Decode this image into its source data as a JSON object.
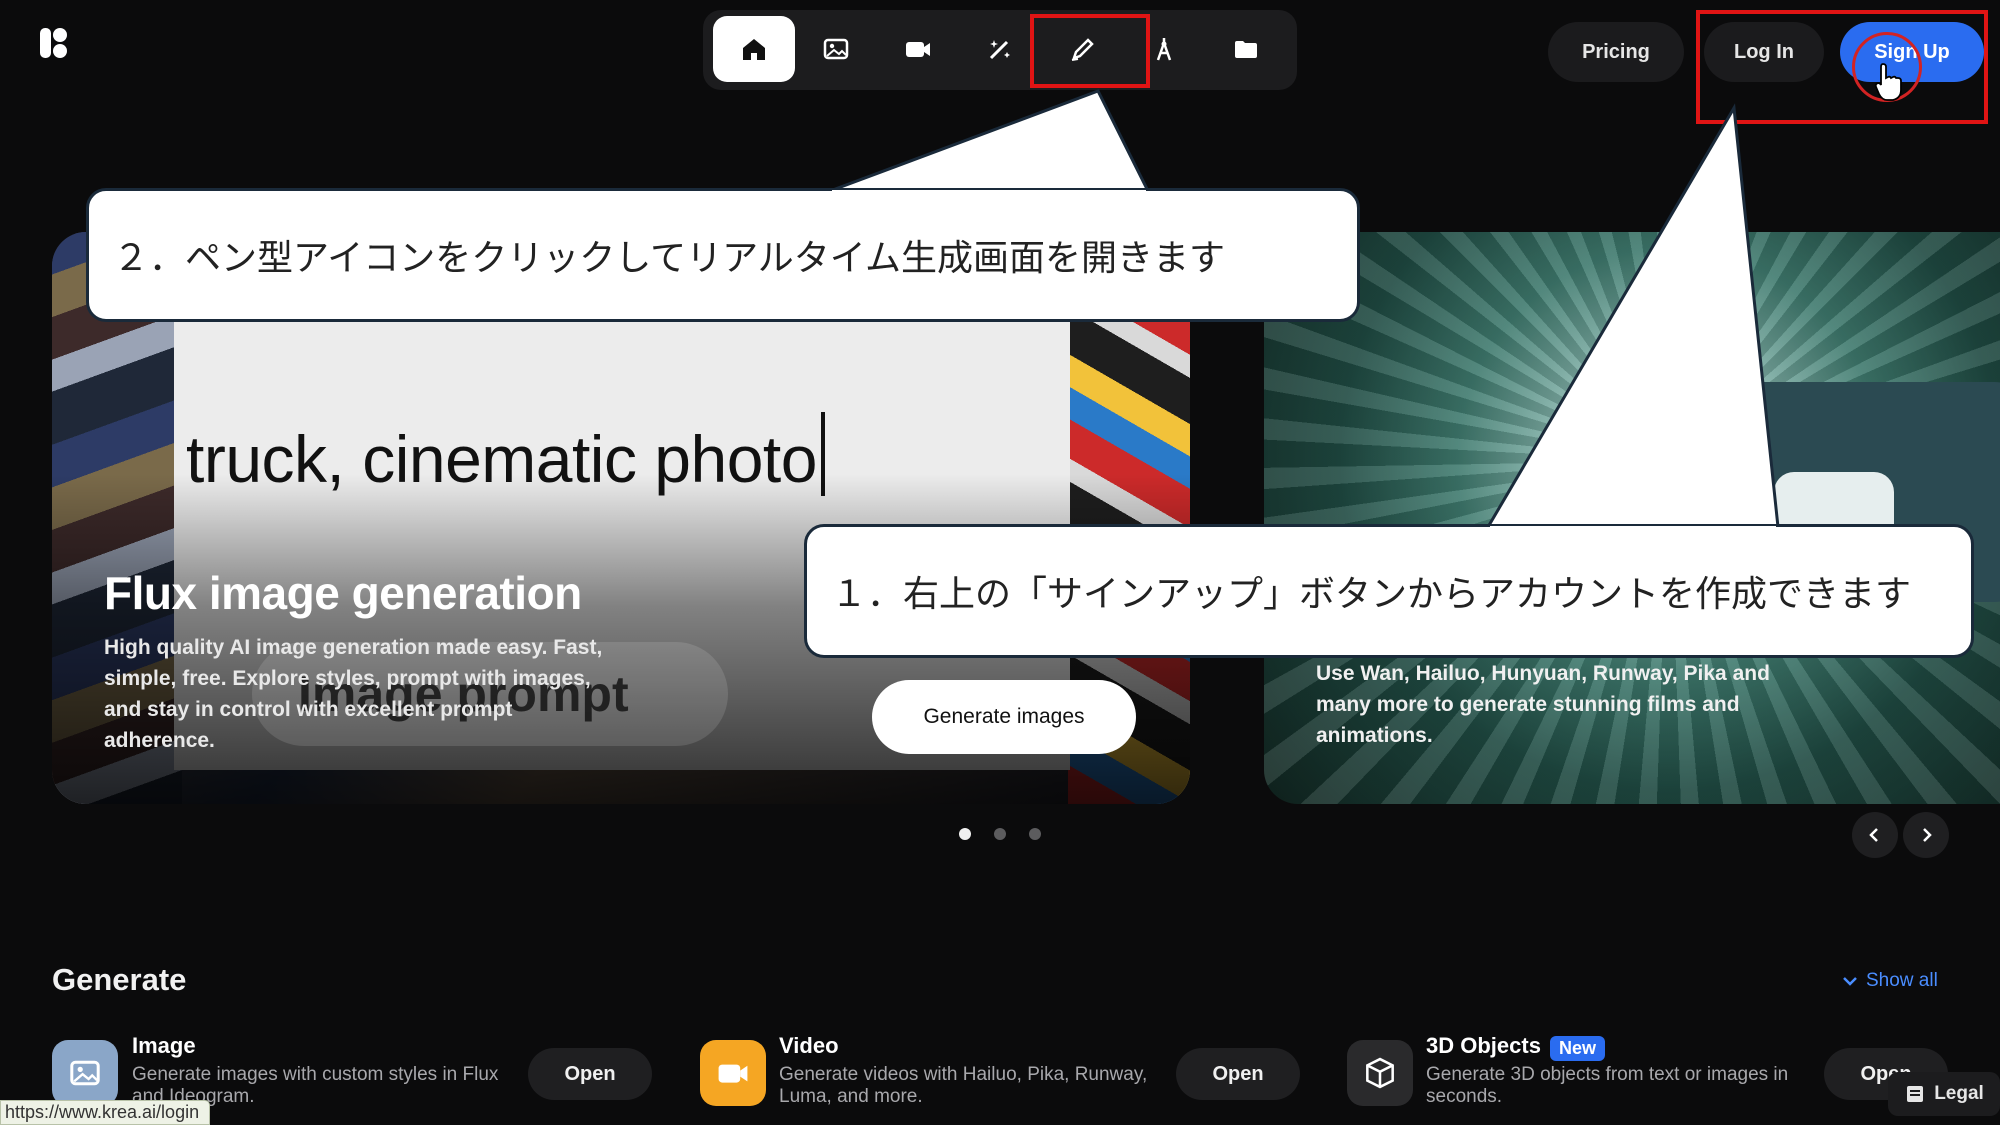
{
  "nav": {
    "icons": [
      "home-icon",
      "image-icon",
      "video-icon",
      "enhance-icon",
      "realtime-pen-icon",
      "train-icon",
      "folder-icon"
    ],
    "active_index": 0
  },
  "header": {
    "pricing_label": "Pricing",
    "login_label": "Log In",
    "signup_label": "Sign Up"
  },
  "hero_left": {
    "prompt_text": "truck, cinematic photo",
    "ghost_label": "Image prompt",
    "title": "Flux image generation",
    "description": "High quality AI image generation made easy. Fast, simple, free. Explore styles, prompt with images, and stay in control with excellent prompt adherence.",
    "button_label": "Generate images"
  },
  "hero_right": {
    "description": "Use Wan, Hailuo, Hunyuan, Runway, Pika and many more to generate stunning films and animations."
  },
  "carousel": {
    "pages": 3,
    "current": 1
  },
  "generate": {
    "heading": "Generate",
    "show_all": "Show all",
    "tools": [
      {
        "name": "Image",
        "desc": "Generate images with custom styles in Flux and Ideogram.",
        "open": "Open",
        "icon": "image-icon",
        "color": "#8aa6c8"
      },
      {
        "name": "Video",
        "desc": "Generate videos with Hailuo, Pika, Runway, Luma, and more.",
        "open": "Open",
        "icon": "video-camera-icon",
        "color": "#f5a623"
      },
      {
        "name": "3D Objects",
        "badge": "New",
        "desc": "Generate 3D objects from text or images in seconds.",
        "open": "Open",
        "icon": "cube-icon",
        "color": "#2a2a2c"
      }
    ]
  },
  "legal_label": "Legal",
  "status_url": "https://www.krea.ai/login",
  "callouts": {
    "step2": "２．ペン型アイコンをクリックしてリアルタイム生成画面を開きます",
    "step1": "１．右上の「サインアップ」ボタンからアカウントを作成できます"
  },
  "colors": {
    "accent": "#2a6cf0",
    "highlight": "#e01414",
    "link": "#4a8dff"
  }
}
